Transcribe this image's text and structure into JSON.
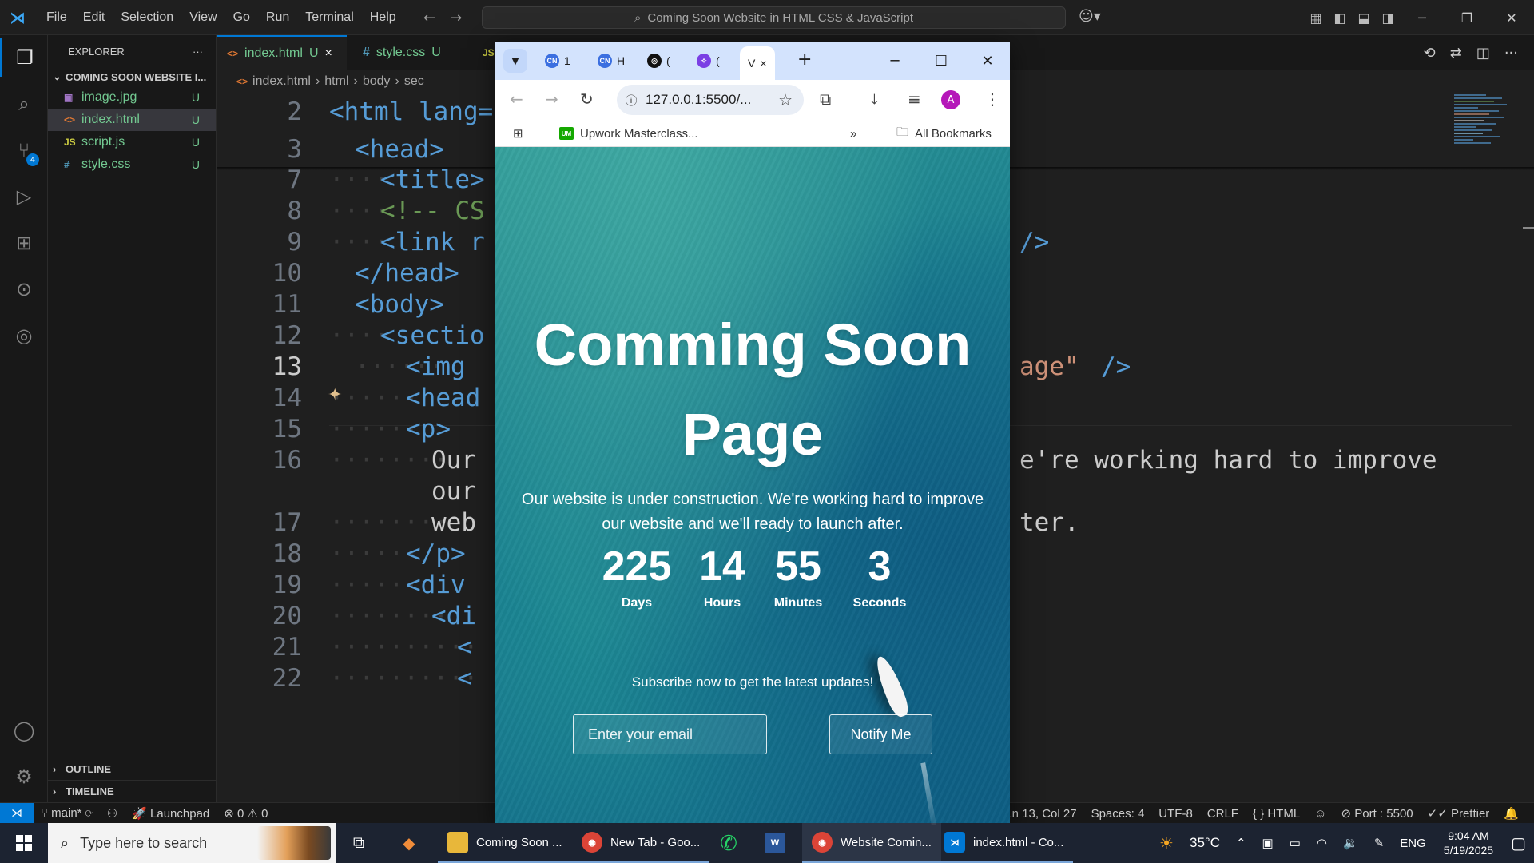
{
  "vscode": {
    "menu": [
      "File",
      "Edit",
      "Selection",
      "View",
      "Go",
      "Run",
      "Terminal",
      "Help"
    ],
    "command_center": "Coming Soon Website in HTML CSS & JavaScript",
    "activity_badge": "4",
    "explorer": {
      "title": "EXPLORER",
      "folder": "COMING SOON WEBSITE I...",
      "files": [
        {
          "icon": "img",
          "name": "image.jpg",
          "status": "U"
        },
        {
          "icon": "<>",
          "name": "index.html",
          "status": "U"
        },
        {
          "icon": "JS",
          "name": "script.js",
          "status": "U"
        },
        {
          "icon": "#",
          "name": "style.css",
          "status": "U"
        }
      ],
      "outline": "OUTLINE",
      "timeline": "TIMELINE"
    },
    "tabs": [
      {
        "icon": "<>",
        "name": "index.html",
        "status": "U",
        "close": "×"
      },
      {
        "icon": "#",
        "name": "style.css",
        "status": "U"
      },
      {
        "icon": "JS",
        "name": ""
      }
    ],
    "breadcrumb": [
      "index.html",
      "html",
      "body",
      "sec"
    ],
    "code": {
      "lines": [
        "2",
        "3",
        "7",
        "8",
        "9",
        "10",
        "11",
        "12",
        "13",
        "14",
        "15",
        "16",
        "",
        "17",
        "18",
        "19",
        "20",
        "21",
        "22"
      ],
      "l2": "<html lang=",
      "l3": "<head>",
      "l7": "<title>",
      "l8": "<!-- CS",
      "l9a": "<link r",
      "l9b": "/>",
      "l10": "</head>",
      "l11": "<body>",
      "l12": "<sectio",
      "l13a": "<img",
      "l13b": "age\"",
      "l13c": "/>",
      "l14": "<head",
      "l15": "<p>",
      "l16a": "Our",
      "l16b": "e're working hard to improve",
      "l16c": "our",
      "l17a": "web",
      "l17b": "ter.",
      "l18": "</p>",
      "l19": "<div",
      "l20": "<di",
      "l21": "<",
      "l22": "<"
    },
    "status": {
      "branch": "main*",
      "launchpad": "Launchpad",
      "problems": "0",
      "warnings": "0",
      "position": "Ln 13, Col 27",
      "spaces": "Spaces: 4",
      "encoding": "UTF-8",
      "eol": "CRLF",
      "language": "HTML",
      "port": "Port : 5500",
      "formatter": "Prettier"
    }
  },
  "browser": {
    "tabs": [
      "1",
      "H",
      "(",
      "(",
      "V"
    ],
    "active_close": "×",
    "new_tab": "+",
    "url": "127.0.0.1:5500/...",
    "avatar": "A",
    "bookmark_1": "Upwork Masterclass...",
    "bookmark_more": "»",
    "all_bookmarks": "All Bookmarks",
    "um_logo": "UM"
  },
  "site": {
    "headline_1": "Comming Soon",
    "headline_2": "Page",
    "subtitle": "Our website is under construction. We're working hard to improve our website and we'll ready to launch after.",
    "countdown": [
      {
        "value": "225",
        "label": "Days"
      },
      {
        "value": "14",
        "label": "Hours"
      },
      {
        "value": "55",
        "label": "Minutes"
      },
      {
        "value": "3",
        "label": "Seconds"
      }
    ],
    "subscribe_text": "Subscribe now to get the latest updates!",
    "email_placeholder": "Enter your email",
    "notify_label": "Notify Me"
  },
  "taskbar": {
    "search_placeholder": "Type here to search",
    "apps": [
      "Coming Soon ...",
      "New Tab - Goo...",
      "Website Comin...",
      "index.html - Co..."
    ],
    "word_icon": "W",
    "weather": "35°C",
    "language": "ENG",
    "time": "9:04 AM",
    "date": "5/19/2025"
  }
}
